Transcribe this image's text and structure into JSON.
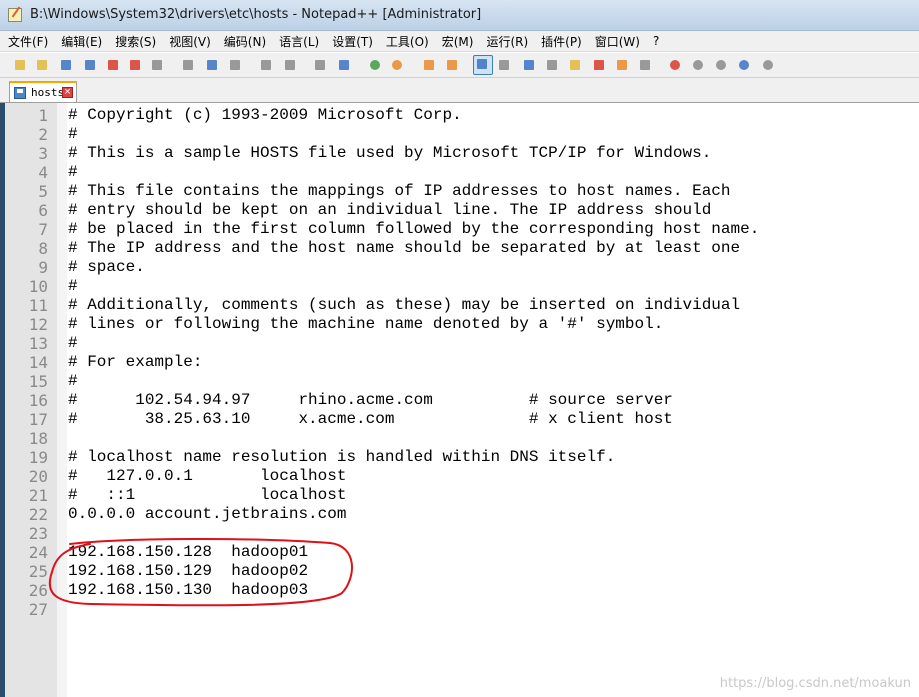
{
  "window": {
    "title": "B:\\Windows\\System32\\drivers\\etc\\hosts - Notepad++ [Administrator]"
  },
  "menu": [
    {
      "label": "文件(F)"
    },
    {
      "label": "编辑(E)"
    },
    {
      "label": "搜索(S)"
    },
    {
      "label": "视图(V)"
    },
    {
      "label": "编码(N)"
    },
    {
      "label": "语言(L)"
    },
    {
      "label": "设置(T)"
    },
    {
      "label": "工具(O)"
    },
    {
      "label": "宏(M)"
    },
    {
      "label": "运行(R)"
    },
    {
      "label": "插件(P)"
    },
    {
      "label": "窗口(W)"
    },
    {
      "label": "?"
    }
  ],
  "toolbar": {
    "icons": [
      "new-file-icon",
      "open-file-icon",
      "save-icon",
      "save-all-icon",
      "close-icon",
      "close-all-icon",
      "print-icon",
      "cut-icon",
      "copy-icon",
      "paste-icon",
      "undo-icon",
      "redo-icon",
      "find-icon",
      "replace-icon",
      "zoom-in-icon",
      "zoom-out-icon",
      "sync-vertical-icon",
      "sync-horizontal-icon",
      "word-wrap-icon",
      "show-all-characters-icon",
      "indent-guide-icon",
      "user-language-icon",
      "document-map-icon",
      "function-list-icon",
      "folder-workspace-icon",
      "monitoring-icon",
      "record-macro-icon",
      "stop-macro-icon",
      "play-macro-icon",
      "run-macro-multiple-icon",
      "save-macro-icon"
    ],
    "colors": {
      "red": "#d83a2a",
      "blue": "#3a72c4",
      "green": "#3f9c3f",
      "yellow": "#e2b93b",
      "gray": "#8a8a8a",
      "orange": "#e88a2a"
    }
  },
  "tabs": [
    {
      "label": "hosts",
      "active": true
    }
  ],
  "editor": {
    "lines": [
      {
        "n": "1",
        "text": "# Copyright (c) 1993-2009 Microsoft Corp."
      },
      {
        "n": "2",
        "text": "#"
      },
      {
        "n": "3",
        "text": "# This is a sample HOSTS file used by Microsoft TCP/IP for Windows."
      },
      {
        "n": "4",
        "text": "#"
      },
      {
        "n": "5",
        "text": "# This file contains the mappings of IP addresses to host names. Each"
      },
      {
        "n": "6",
        "text": "# entry should be kept on an individual line. The IP address should"
      },
      {
        "n": "7",
        "text": "# be placed in the first column followed by the corresponding host name."
      },
      {
        "n": "8",
        "text": "# The IP address and the host name should be separated by at least one"
      },
      {
        "n": "9",
        "text": "# space."
      },
      {
        "n": "10",
        "text": "#"
      },
      {
        "n": "11",
        "text": "# Additionally, comments (such as these) may be inserted on individual"
      },
      {
        "n": "12",
        "text": "# lines or following the machine name denoted by a '#' symbol."
      },
      {
        "n": "13",
        "text": "#"
      },
      {
        "n": "14",
        "text": "# For example:"
      },
      {
        "n": "15",
        "text": "#"
      },
      {
        "n": "16",
        "text": "#      102.54.94.97     rhino.acme.com          # source server"
      },
      {
        "n": "17",
        "text": "#       38.25.63.10     x.acme.com              # x client host"
      },
      {
        "n": "18",
        "text": ""
      },
      {
        "n": "19",
        "text": "# localhost name resolution is handled within DNS itself."
      },
      {
        "n": "20",
        "text": "#   127.0.0.1       localhost"
      },
      {
        "n": "21",
        "text": "#   ::1             localhost"
      },
      {
        "n": "22",
        "text": "0.0.0.0 account.jetbrains.com"
      },
      {
        "n": "23",
        "text": ""
      },
      {
        "n": "24",
        "text": "192.168.150.128  hadoop01"
      },
      {
        "n": "25",
        "text": "192.168.150.129  hadoop02"
      },
      {
        "n": "26",
        "text": "192.168.150.130  hadoop03"
      },
      {
        "n": "27",
        "text": ""
      }
    ]
  },
  "annotation": {
    "color": "#e0101a"
  },
  "watermark": "https://blog.csdn.net/moakun"
}
